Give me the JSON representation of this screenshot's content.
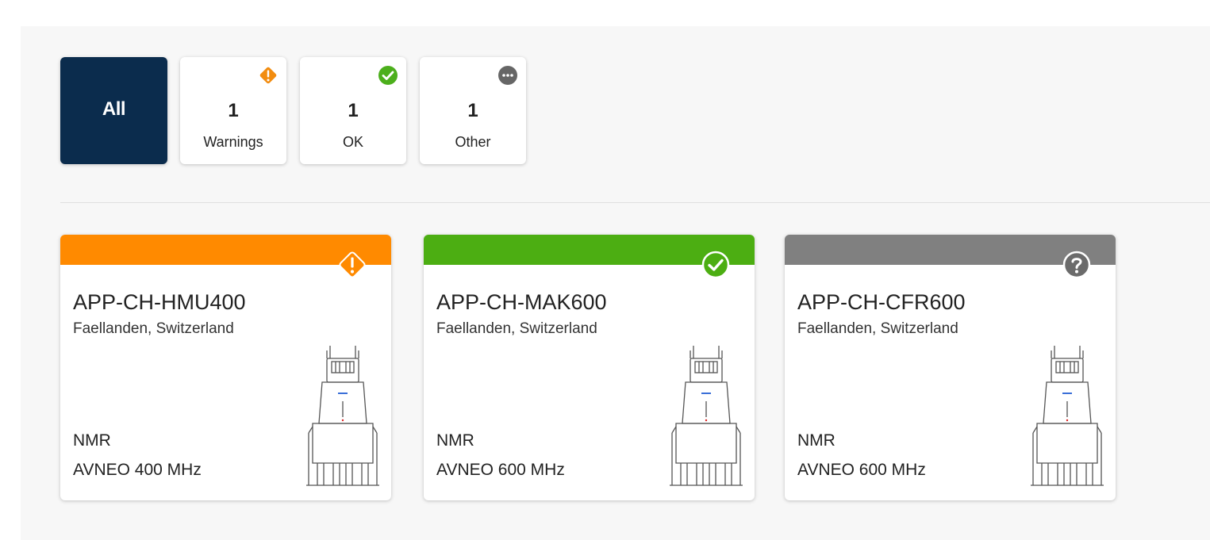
{
  "filters": {
    "all_label": "All",
    "items": [
      {
        "count": "1",
        "label": "Warnings",
        "icon": "warning-diamond-icon",
        "color": "#f28c0f"
      },
      {
        "count": "1",
        "label": "OK",
        "icon": "check-circle-icon",
        "color": "#4caf1c"
      },
      {
        "count": "1",
        "label": "Other",
        "icon": "more-dots-icon",
        "color": "#666666"
      }
    ]
  },
  "colors": {
    "warning": "#ff8a00",
    "ok": "#4cae12",
    "other": "#808080",
    "selected_filter": "#0b2c4d"
  },
  "instruments": [
    {
      "name": "APP-CH-HMU400",
      "location": "Faellanden, Switzerland",
      "type": "NMR",
      "model": "AVNEO 400 MHz",
      "status": "warning",
      "icon": "warning-diamond-icon"
    },
    {
      "name": "APP-CH-MAK600",
      "location": "Faellanden, Switzerland",
      "type": "NMR",
      "model": "AVNEO 600 MHz",
      "status": "ok",
      "icon": "check-circle-icon"
    },
    {
      "name": "APP-CH-CFR600",
      "location": "Faellanden, Switzerland",
      "type": "NMR",
      "model": "AVNEO 600 MHz",
      "status": "other",
      "icon": "question-circle-icon"
    }
  ]
}
